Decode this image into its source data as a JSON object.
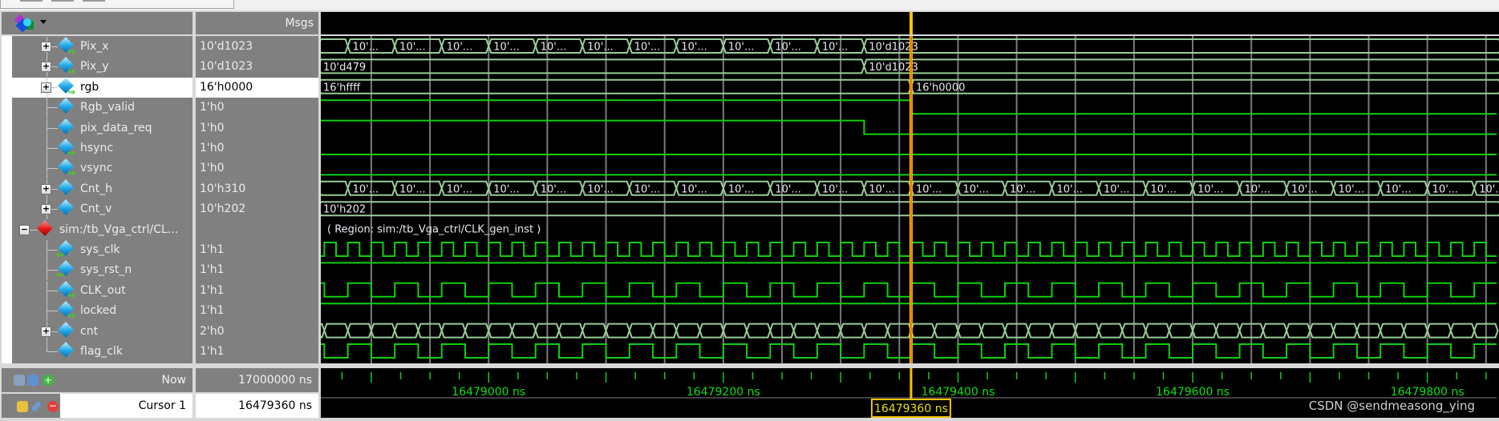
{
  "header": {
    "msgs_label": "Msgs",
    "wave_icon": "wave-signals-icon"
  },
  "colors": {
    "bus": "#98cc98",
    "logic": "#10d010",
    "grid": "#7a7a7a",
    "cursor": "#f5c400",
    "cursor_text": "#e8e000",
    "axis_text": "#10e010",
    "selected_bg": "#ffffff"
  },
  "timeline": {
    "visible_range_ns": [
      16478857,
      16479859
    ],
    "grid_step_ns": 50,
    "tick_step_ns": 25,
    "labels": [
      "16479000 ns",
      "16479200 ns",
      "16479400 ns",
      "16479600 ns",
      "16479800 ns"
    ],
    "label_times_ns": [
      16479000,
      16479200,
      16479400,
      16479600,
      16479800
    ]
  },
  "signals": [
    {
      "name": "Pix_x",
      "value": "10'd1023",
      "expand": "+",
      "icon": "signal-output-icon",
      "wave": {
        "type": "bus",
        "period_ns": 40,
        "label": "10'...",
        "until_ns": 16479320,
        "then": "10'd1023",
        "then_display": "10'd1023"
      }
    },
    {
      "name": "Pix_y",
      "value": "10'd1023",
      "expand": "+",
      "icon": "signal-output-icon",
      "wave": {
        "type": "bus",
        "segments": [
          {
            "from": null,
            "label": "10'd479"
          },
          {
            "from": 16479320,
            "label": "10'd1023"
          }
        ]
      }
    },
    {
      "name": "rgb",
      "value": "16'h0000",
      "expand": "+",
      "icon": "signal-output-icon",
      "selected": true,
      "wave": {
        "type": "bus",
        "segments": [
          {
            "from": null,
            "label": "16'hffff"
          },
          {
            "from": 16479360,
            "label": "16'h0000"
          }
        ]
      }
    },
    {
      "name": "Rgb_valid",
      "value": "1'h0",
      "icon": "signal-icon",
      "wave": {
        "type": "level",
        "segments": [
          {
            "from": null,
            "v": 1
          },
          {
            "from": 16479360,
            "v": 0
          }
        ]
      }
    },
    {
      "name": "pix_data_req",
      "value": "1'h0",
      "icon": "signal-icon",
      "wave": {
        "type": "level",
        "segments": [
          {
            "from": null,
            "v": 1
          },
          {
            "from": 16479320,
            "v": 0
          }
        ]
      }
    },
    {
      "name": "hsync",
      "value": "1'h0",
      "icon": "signal-output-icon",
      "wave": {
        "type": "level",
        "segments": [
          {
            "from": null,
            "v": 0
          }
        ]
      }
    },
    {
      "name": "vsync",
      "value": "1'h0",
      "icon": "signal-output-icon",
      "wave": {
        "type": "level",
        "segments": [
          {
            "from": null,
            "v": 0
          }
        ]
      }
    },
    {
      "name": "Cnt_h",
      "value": "10'h310",
      "expand": "+",
      "icon": "signal-icon",
      "wave": {
        "type": "bus",
        "period_ns": 40,
        "label": "10'..."
      }
    },
    {
      "name": "Cnt_v",
      "value": "10'h202",
      "expand": "+",
      "icon": "signal-icon",
      "wave": {
        "type": "bus",
        "segments": [
          {
            "from": null,
            "label": "10'h202"
          }
        ]
      }
    },
    {
      "name": "sim:/tb_Vga_ctrl/CL...",
      "value": "",
      "expand": "-",
      "icon": "region-icon",
      "region": true,
      "wave": {
        "type": "text",
        "label": "( Region: sim:/tb_Vga_ctrl/CLK_gen_inst )"
      }
    },
    {
      "name": "sys_clk",
      "value": "1'h1",
      "icon": "signal-input-icon",
      "wave": {
        "type": "clock",
        "period_ns": 20,
        "high_ns": 10
      }
    },
    {
      "name": "sys_rst_n",
      "value": "1'h1",
      "icon": "signal-input-icon",
      "wave": {
        "type": "level",
        "segments": [
          {
            "from": null,
            "v": 1
          }
        ]
      }
    },
    {
      "name": "CLK_out",
      "value": "1'h1",
      "icon": "signal-output-icon",
      "wave": {
        "type": "clock",
        "period_ns": 40,
        "high_ns": 20
      }
    },
    {
      "name": "locked",
      "value": "1'h1",
      "icon": "signal-output-icon",
      "wave": {
        "type": "level",
        "segments": [
          {
            "from": null,
            "v": 1
          }
        ]
      }
    },
    {
      "name": "cnt",
      "value": "2'h0",
      "expand": "+",
      "icon": "signal-icon",
      "wave": {
        "type": "bus",
        "period_ns": 20,
        "label": ""
      }
    },
    {
      "name": "flag_clk",
      "value": "1'h1",
      "icon": "signal-icon",
      "last": true,
      "wave": {
        "type": "clock",
        "period_ns": 40,
        "high_ns": 20
      }
    }
  ],
  "footer": {
    "now_label": "Now",
    "now_value": "17000000 ns",
    "cursor_label": "Cursor 1",
    "cursor_value": "16479360 ns",
    "cursor_time_ns": 16479360,
    "cursor_box": "16479360 ns",
    "watermark": "CSDN @sendmeasong_ying"
  }
}
